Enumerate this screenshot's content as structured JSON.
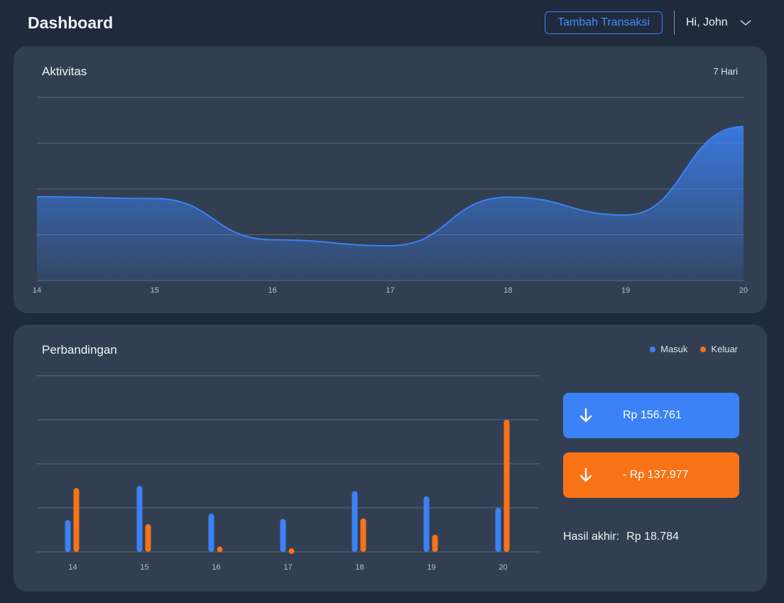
{
  "header": {
    "title": "Dashboard",
    "add_button": "Tambah Transaksi",
    "greeting": "Hi, John"
  },
  "activity": {
    "title": "Aktivitas",
    "range": "7 Hari"
  },
  "comparison": {
    "title": "Perbandingan",
    "legend_in": "Masuk",
    "legend_out": "Keluar",
    "total_in": "Rp 156.761",
    "total_out": "- Rp 137.977",
    "final_label": "Hasil akhir:",
    "final_value": "Rp 18.784"
  },
  "colors": {
    "in": "#3b82f6",
    "out": "#f97316",
    "line": "#3b82f6"
  },
  "chart_data": [
    {
      "type": "area",
      "title": "Aktivitas",
      "x": [
        "14",
        "15",
        "16",
        "17",
        "18",
        "19",
        "20"
      ],
      "values": [
        1.83,
        1.79,
        0.89,
        0.76,
        1.82,
        1.43,
        3.36
      ],
      "ylim": [
        0,
        4
      ],
      "grid": true
    },
    {
      "type": "bar",
      "title": "Perbandingan",
      "categories": [
        "14",
        "15",
        "16",
        "17",
        "18",
        "19",
        "20"
      ],
      "series": [
        {
          "name": "Masuk",
          "values": [
            0.72,
            1.5,
            0.87,
            0.75,
            1.38,
            1.26,
            1.0
          ]
        },
        {
          "name": "Keluar",
          "values": [
            1.45,
            0.63,
            0.12,
            0.08,
            0.76,
            0.39,
            3.0
          ]
        }
      ],
      "ylim": [
        0,
        4
      ],
      "grid": true,
      "legend": "top-right"
    }
  ]
}
